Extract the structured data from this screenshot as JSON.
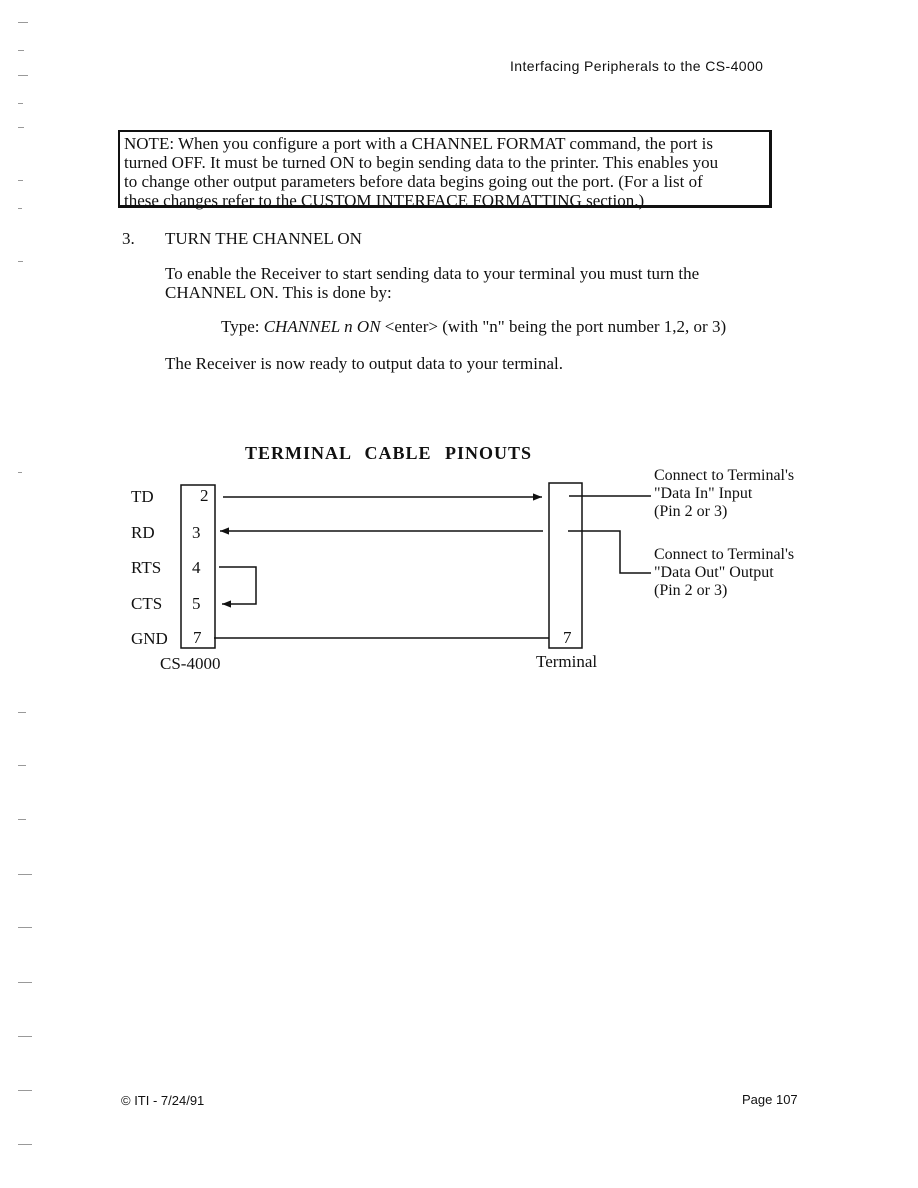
{
  "header": {
    "running_title": "Interfacing Peripherals to the CS-4000"
  },
  "note": {
    "lines": [
      "NOTE: When you configure a port with a CHANNEL FORMAT command, the port is",
      "turned OFF.  It must be turned ON to begin sending data to the printer.  This enables you",
      "to change other output parameters before data begins going out the port.  (For a list of",
      "these changes refer to the CUSTOM INTERFACE FORMATTING section.)"
    ]
  },
  "step": {
    "number": "3.",
    "title": "TURN THE CHANNEL ON",
    "paragraph_lines": [
      "To enable the Receiver to start sending data to your terminal you must turn the",
      "CHANNEL ON.  This is done by:"
    ],
    "type_prefix": "Type:  ",
    "type_command": "CHANNEL n ON",
    "type_suffix": " <enter> (with \"n\" being the port number 1,2, or 3)",
    "closing": "The Receiver is now ready to output data to your terminal."
  },
  "diagram": {
    "title": "TERMINAL   CABLE   PINOUTS",
    "signals": [
      {
        "name": "TD",
        "pin": "2"
      },
      {
        "name": "RD",
        "pin": "3"
      },
      {
        "name": "RTS",
        "pin": "4"
      },
      {
        "name": "CTS",
        "pin": "5"
      },
      {
        "name": "GND",
        "pin": "7"
      }
    ],
    "left_connector_label": "CS-4000",
    "right_connector_label": "Terminal",
    "right_connector_pin": "7",
    "data_in_note": [
      "Connect to Terminal's",
      "\"Data In\" Input",
      "(Pin 2 or 3)"
    ],
    "data_out_note": [
      "Connect to Terminal's",
      "\"Data Out\" Output",
      "(Pin 2 or 3)"
    ]
  },
  "footer": {
    "left": "© ITI - 7/24/91",
    "right": "Page 107"
  }
}
